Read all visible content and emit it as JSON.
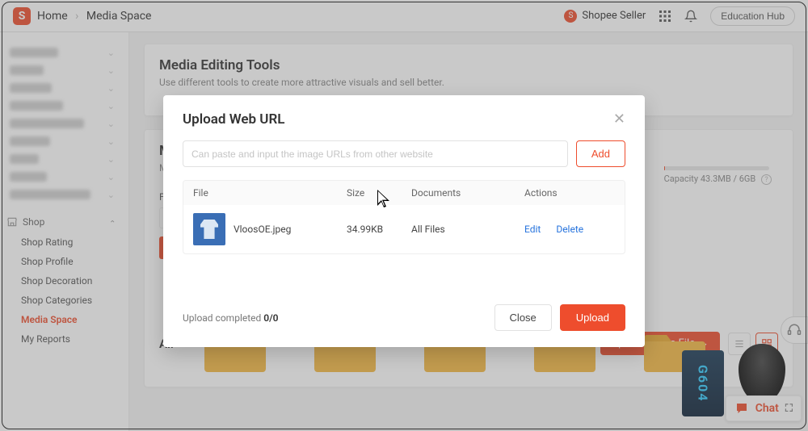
{
  "header": {
    "home": "Home",
    "page": "Media Space",
    "seller": "Shopee Seller",
    "edu": "Education Hub"
  },
  "sidebar": {
    "shop_label": "Shop",
    "items": [
      {
        "label": "Shop Rating"
      },
      {
        "label": "Shop Profile"
      },
      {
        "label": "Shop Decoration"
      },
      {
        "label": "Shop Categories"
      },
      {
        "label": "Media Space"
      },
      {
        "label": "My Reports"
      }
    ]
  },
  "main": {
    "tools_title": "Media Editing Tools",
    "tools_sub": "Use different tools to create more attractive visuals and sell better.",
    "ms_prefix": "M",
    "ms_sub": "Ma",
    "file_lbl": "File",
    "all_lbl": "All",
    "upload_btn": "Upload Media File",
    "capacity": "Capacity 43.3MB / 6GB"
  },
  "modal": {
    "title": "Upload Web URL",
    "placeholder": "Can paste and input the image URLs from other website",
    "add": "Add",
    "cols": {
      "file": "File",
      "size": "Size",
      "docs": "Documents",
      "actions": "Actions"
    },
    "row": {
      "name": "VloosOE.jpeg",
      "size": "34.99KB",
      "docs": "All Files",
      "edit": "Edit",
      "del": "Delete"
    },
    "status_prefix": "Upload completed ",
    "status_count": "0/0",
    "close": "Close",
    "upload": "Upload"
  },
  "chat": {
    "label": "Chat"
  },
  "hw1": "G604"
}
